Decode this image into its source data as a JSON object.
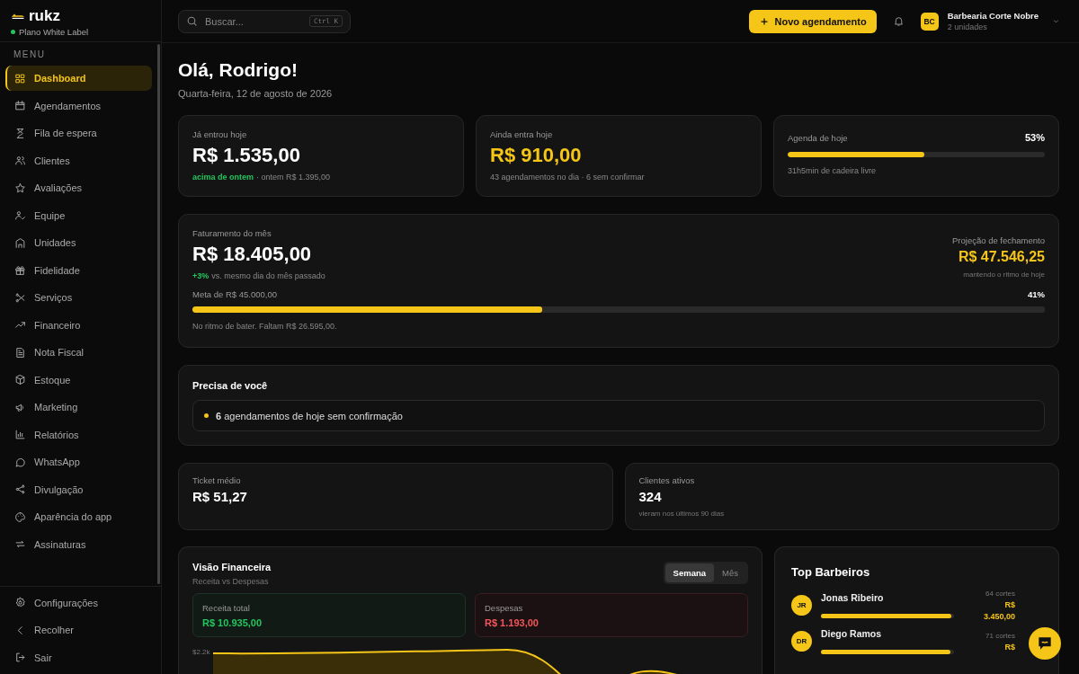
{
  "brand": {
    "name": "rukz",
    "plan": "Plano White Label"
  },
  "search": {
    "placeholder": "Buscar...",
    "shortcut": "Ctrl K"
  },
  "header": {
    "new_button": "Novo agendamento",
    "account": {
      "initials": "BC",
      "name": "Barbearia Corte Nobre",
      "subtitle": "2 unidades"
    }
  },
  "sidebar": {
    "heading": "MENU",
    "items": [
      {
        "label": "Dashboard",
        "selected": true
      },
      {
        "label": "Agendamentos",
        "selected": false
      },
      {
        "label": "Fila de espera",
        "selected": false
      },
      {
        "label": "Clientes",
        "selected": false
      },
      {
        "label": "Avaliações",
        "selected": false
      },
      {
        "label": "Equipe",
        "selected": false
      },
      {
        "label": "Unidades",
        "selected": false
      },
      {
        "label": "Fidelidade",
        "selected": false
      },
      {
        "label": "Serviços",
        "selected": false
      },
      {
        "label": "Financeiro",
        "selected": false
      },
      {
        "label": "Nota Fiscal",
        "selected": false
      },
      {
        "label": "Estoque",
        "selected": false
      },
      {
        "label": "Marketing",
        "selected": false
      },
      {
        "label": "Relatórios",
        "selected": false
      },
      {
        "label": "WhatsApp",
        "selected": false
      },
      {
        "label": "Divulgação",
        "selected": false
      },
      {
        "label": "Aparência do app",
        "selected": false
      },
      {
        "label": "Assinaturas",
        "selected": false
      }
    ],
    "footer_items": [
      {
        "label": "Configurações"
      },
      {
        "label": "Recolher"
      },
      {
        "label": "Sair"
      }
    ]
  },
  "greeting": {
    "title": "Olá, Rodrigo!",
    "date": "Quarta-feira, 12 de agosto de 2026"
  },
  "stats": [
    {
      "kind": "amount",
      "label": "Já entrou hoje",
      "value": "R$ 1.535,00",
      "accent": false,
      "trend": "acima de ontem",
      "note": "· ontem R$ 1.395,00"
    },
    {
      "kind": "amount",
      "label": "Ainda entra hoje",
      "value": "R$ 910,00",
      "accent": true,
      "note": "43 agendamentos no dia · 6 sem confirmar"
    },
    {
      "kind": "progress",
      "label": "Agenda de hoje",
      "percent": "53%",
      "level": 0.53,
      "note": "31h5min de cadeira livre"
    }
  ],
  "month": {
    "label": "Faturamento do mês",
    "value": "R$ 18.405,00",
    "trend": "+3%",
    "trend_note": "vs. mesmo dia do mês passado",
    "projection_label": "Projeção de fechamento",
    "projection_value": "R$ 47.546,25",
    "projection_note": "mantendo o ritmo de hoje",
    "goal_label": "Meta de R$ 45.000,00",
    "goal_percent": "41%",
    "level": 0.41,
    "goal_note": "No ritmo de bater. Faltam R$ 26.595,00."
  },
  "attention": {
    "title": "Precisa de você",
    "items": [
      {
        "text": "**6** agendamentos de hoje sem confirmação"
      }
    ]
  },
  "metrics": [
    {
      "label": "Ticket médio",
      "value": "R$ 51,27"
    },
    {
      "label": "Clientes ativos",
      "value": "324",
      "note": "vieram nos últimos 90 dias"
    }
  ],
  "finance": {
    "title": "Visão Financeira",
    "subtitle": "Receita vs Despesas",
    "periods": [
      {
        "label": "Semana",
        "selected": true
      },
      {
        "label": "Mês",
        "selected": false
      }
    ],
    "totals": [
      {
        "kind": "income",
        "label": "Receita total",
        "value": "R$ 10.935,00"
      },
      {
        "kind": "expense",
        "label": "Despesas",
        "value": "R$ 1.193,00"
      }
    ],
    "y_tick": "$2.2k"
  },
  "top_barbers": {
    "title": "Top Barbeiros",
    "rows": [
      {
        "initials": "JR",
        "name": "Jonas Ribeiro",
        "count": "64 cortes",
        "currency": "R$",
        "amount": "3.450,00",
        "level": 0.98
      },
      {
        "initials": "DR",
        "name": "Diego Ramos",
        "count": "71 cortes",
        "currency": "R$",
        "level": 0.97
      }
    ]
  }
}
